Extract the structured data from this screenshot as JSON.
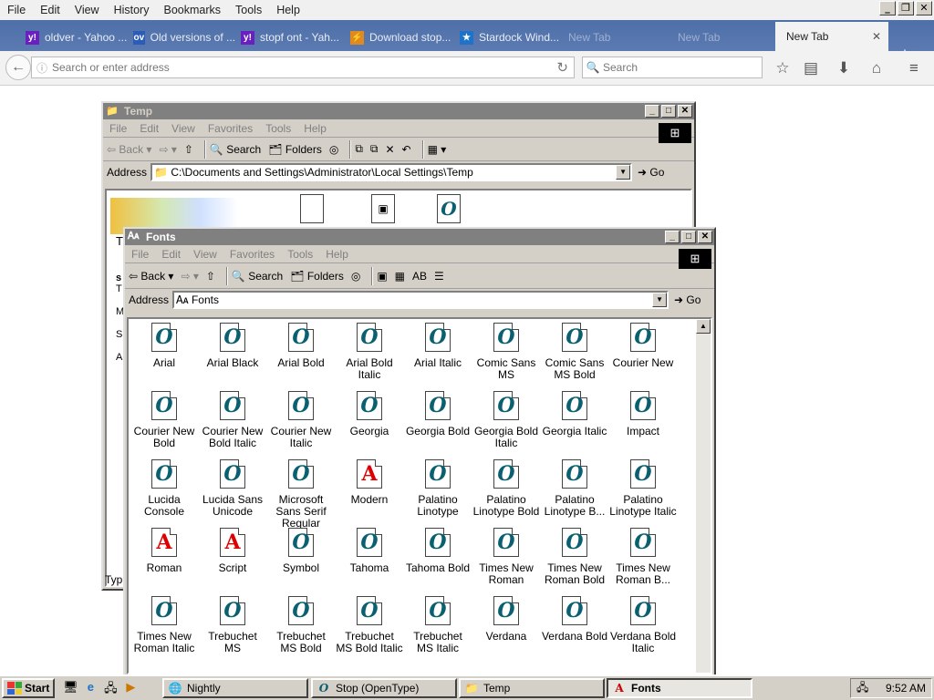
{
  "browser": {
    "menu": [
      "File",
      "Edit",
      "View",
      "History",
      "Bookmarks",
      "Tools",
      "Help"
    ],
    "tabs": [
      {
        "label": "oldver - Yahoo ...",
        "icon": "y!",
        "icon_color": "#6a1fbf"
      },
      {
        "label": "Old versions of ...",
        "icon": "ov",
        "icon_color": "#2b5cb8"
      },
      {
        "label": "stopf ont - Yah...",
        "icon": "y!",
        "icon_color": "#6a1fbf"
      },
      {
        "label": "Download stop...",
        "icon": "⚡",
        "icon_color": "#e08a1e"
      },
      {
        "label": "Stardock Wind...",
        "icon": "★",
        "icon_color": "#1e73c9"
      },
      {
        "label": "New Tab"
      },
      {
        "label": "New Tab"
      },
      {
        "label": "New Tab"
      }
    ],
    "url_placeholder": "Search or enter address",
    "search_placeholder": "Search"
  },
  "temp_window": {
    "title": "Temp",
    "menu": [
      "File",
      "Edit",
      "View",
      "Favorites",
      "Tools",
      "Help"
    ],
    "toolbar": {
      "back": "Back",
      "search": "Search",
      "folders": "Folders"
    },
    "address_label": "Address",
    "address": "C:\\Documents and Settings\\Administrator\\Local Settings\\Temp",
    "go": "Go",
    "side_text": [
      "T",
      "s",
      "T",
      "M",
      "S",
      "A"
    ],
    "status_fragment": "Typ"
  },
  "fonts_window": {
    "title": "Fonts",
    "menu": [
      "File",
      "Edit",
      "View",
      "Favorites",
      "Tools",
      "Help"
    ],
    "toolbar": {
      "back": "Back",
      "search": "Search",
      "folders": "Folders"
    },
    "address_label": "Address",
    "address": "Fonts",
    "go": "Go",
    "fonts": [
      {
        "name": "Arial",
        "type": "O"
      },
      {
        "name": "Arial Black",
        "type": "O"
      },
      {
        "name": "Arial Bold",
        "type": "O"
      },
      {
        "name": "Arial Bold Italic",
        "type": "O"
      },
      {
        "name": "Arial Italic",
        "type": "O"
      },
      {
        "name": "Comic Sans MS",
        "type": "O"
      },
      {
        "name": "Comic Sans MS Bold",
        "type": "O"
      },
      {
        "name": "Courier New",
        "type": "O"
      },
      {
        "name": "Courier New Bold",
        "type": "O"
      },
      {
        "name": "Courier New Bold Italic",
        "type": "O"
      },
      {
        "name": "Courier New Italic",
        "type": "O"
      },
      {
        "name": "Georgia",
        "type": "O"
      },
      {
        "name": "Georgia Bold",
        "type": "O"
      },
      {
        "name": "Georgia Bold Italic",
        "type": "O"
      },
      {
        "name": "Georgia Italic",
        "type": "O"
      },
      {
        "name": "Impact",
        "type": "O"
      },
      {
        "name": "Lucida Console",
        "type": "O"
      },
      {
        "name": "Lucida Sans Unicode",
        "type": "O"
      },
      {
        "name": "Microsoft Sans Serif Regular",
        "type": "O"
      },
      {
        "name": "Modern",
        "type": "A"
      },
      {
        "name": "Palatino Linotype",
        "type": "O"
      },
      {
        "name": "Palatino Linotype Bold",
        "type": "O"
      },
      {
        "name": "Palatino Linotype B...",
        "type": "O"
      },
      {
        "name": "Palatino Linotype Italic",
        "type": "O"
      },
      {
        "name": "Roman",
        "type": "A"
      },
      {
        "name": "Script",
        "type": "A"
      },
      {
        "name": "Symbol",
        "type": "O"
      },
      {
        "name": "Tahoma",
        "type": "O"
      },
      {
        "name": "Tahoma Bold",
        "type": "O"
      },
      {
        "name": "Times New Roman",
        "type": "O"
      },
      {
        "name": "Times New Roman Bold",
        "type": "O"
      },
      {
        "name": "Times New Roman B...",
        "type": "O"
      },
      {
        "name": "Times New Roman Italic",
        "type": "O"
      },
      {
        "name": "Trebuchet MS",
        "type": "O"
      },
      {
        "name": "Trebuchet MS Bold",
        "type": "O"
      },
      {
        "name": "Trebuchet MS Bold Italic",
        "type": "O"
      },
      {
        "name": "Trebuchet MS Italic",
        "type": "O"
      },
      {
        "name": "Verdana",
        "type": "O"
      },
      {
        "name": "Verdana Bold",
        "type": "O"
      },
      {
        "name": "Verdana Bold Italic",
        "type": "O"
      }
    ]
  },
  "taskbar": {
    "start": "Start",
    "tasks": [
      {
        "label": "Nightly",
        "icon": "🌐"
      },
      {
        "label": "Stop (OpenType)",
        "icon": "O"
      },
      {
        "label": "Temp",
        "icon": "📁"
      },
      {
        "label": "Fonts",
        "icon": "A"
      }
    ],
    "clock": "9:52 AM"
  }
}
